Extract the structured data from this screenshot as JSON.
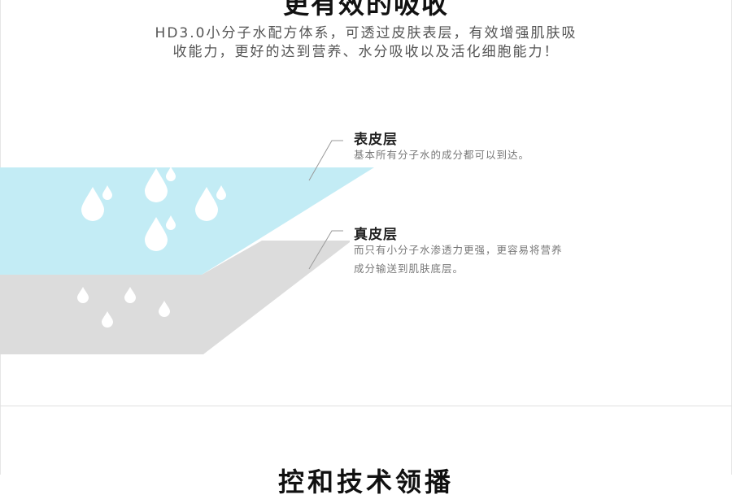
{
  "header": {
    "title": "更有效的吸收",
    "intro_lines": [
      "HD3.0小分子水配方体系，可透过皮肤表层，有效增强肌肤吸",
      "收能力，更好的达到营养、水分吸收以及活化细胞能力！"
    ]
  },
  "layers": [
    {
      "title": "表皮层",
      "desc_lines": [
        "基本所有分子水的成分都可以到达。"
      ],
      "color": "#c3ecf5"
    },
    {
      "title": "真皮层",
      "desc_lines": [
        "而只有小分子水渗透力更强，更容易将营养",
        "成分输送到肌肤底层。"
      ],
      "color": "#dcdcdc"
    }
  ],
  "next_section": {
    "title": "控和技术领播"
  }
}
